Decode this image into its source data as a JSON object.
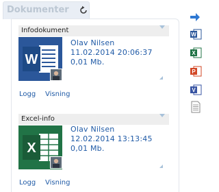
{
  "tab": {
    "title": "Dokumenter",
    "refresh_icon": "refresh-icon"
  },
  "cards": [
    {
      "header": "Infodokument",
      "app_icon": "word-document-icon",
      "author": "Olav Nilsen",
      "datetime": "11.02.2014 20:06:37",
      "size": "0,01 Mb.",
      "links": {
        "log": "Logg",
        "view": "Visning"
      }
    },
    {
      "header": "Excel-info",
      "app_icon": "excel-document-icon",
      "author": "Olav Nilsen",
      "datetime": "12.02.2014 13:13:45",
      "size": "0,01 Mb.",
      "links": {
        "log": "Logg",
        "view": "Visning"
      }
    }
  ],
  "sidebar_icons": [
    "arrow-right-icon",
    "word-icon",
    "excel-icon",
    "powerpoint-icon",
    "visio-icon",
    "text-file-icon"
  ],
  "colors": {
    "link": "#1f5aa6",
    "word": "#2b579a",
    "excel": "#217346",
    "powerpoint": "#d24726",
    "visio": "#3955a3"
  }
}
